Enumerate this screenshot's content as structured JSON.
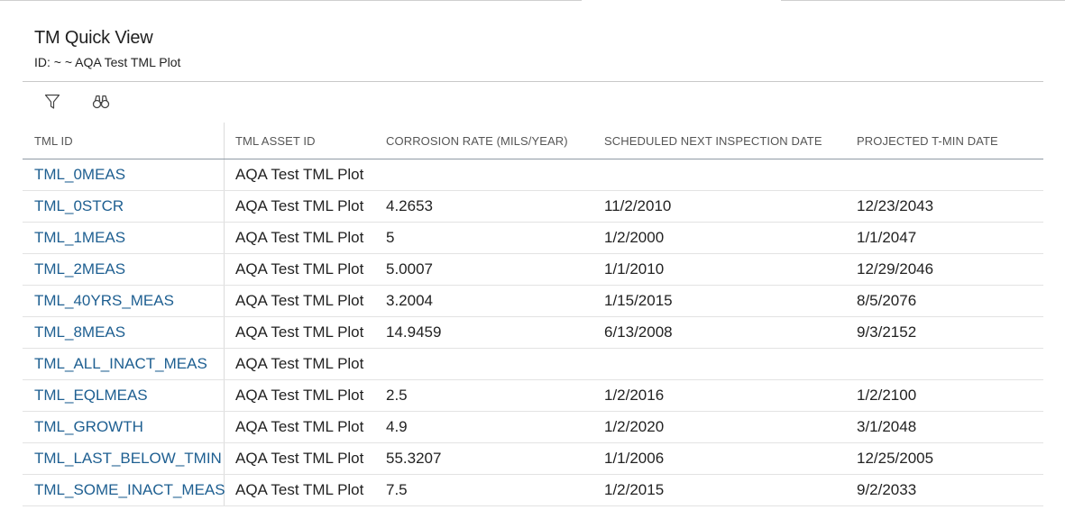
{
  "page": {
    "title": "TM Quick View",
    "subtitle": "ID: ~ ~ AQA Test TML Plot"
  },
  "toolbar": {
    "icons": [
      "filter-icon",
      "binoculars-icon"
    ]
  },
  "table": {
    "columns": [
      "TML ID",
      "TML ASSET ID",
      "CORROSION RATE (MILS/YEAR)",
      "SCHEDULED NEXT INSPECTION DATE",
      "PROJECTED T-MIN DATE"
    ],
    "rows": [
      [
        "TML_0MEAS",
        "AQA Test TML Plot",
        "",
        "",
        ""
      ],
      [
        "TML_0STCR",
        "AQA Test TML Plot",
        "4.2653",
        "11/2/2010",
        "12/23/2043"
      ],
      [
        "TML_1MEAS",
        "AQA Test TML Plot",
        "5",
        "1/2/2000",
        "1/1/2047"
      ],
      [
        "TML_2MEAS",
        "AQA Test TML Plot",
        "5.0007",
        "1/1/2010",
        "12/29/2046"
      ],
      [
        "TML_40YRS_MEAS",
        "AQA Test TML Plot",
        "3.2004",
        "1/15/2015",
        "8/5/2076"
      ],
      [
        "TML_8MEAS",
        "AQA Test TML Plot",
        "14.9459",
        "6/13/2008",
        "9/3/2152"
      ],
      [
        "TML_ALL_INACT_MEAS",
        "AQA Test TML Plot",
        "",
        "",
        ""
      ],
      [
        "TML_EQLMEAS",
        "AQA Test TML Plot",
        "2.5",
        "1/2/2016",
        "1/2/2100"
      ],
      [
        "TML_GROWTH",
        "AQA Test TML Plot",
        "4.9",
        "1/2/2020",
        "3/1/2048"
      ],
      [
        "TML_LAST_BELOW_TMIN",
        "AQA Test TML Plot",
        "55.3207",
        "1/1/2006",
        "12/25/2005"
      ],
      [
        "TML_SOME_INACT_MEAS",
        "AQA Test TML Plot",
        "7.5",
        "1/2/2015",
        "9/2/2033"
      ]
    ]
  },
  "colors": {
    "link": "#1e5f91",
    "header_text": "#555555",
    "body_text": "#222222"
  }
}
